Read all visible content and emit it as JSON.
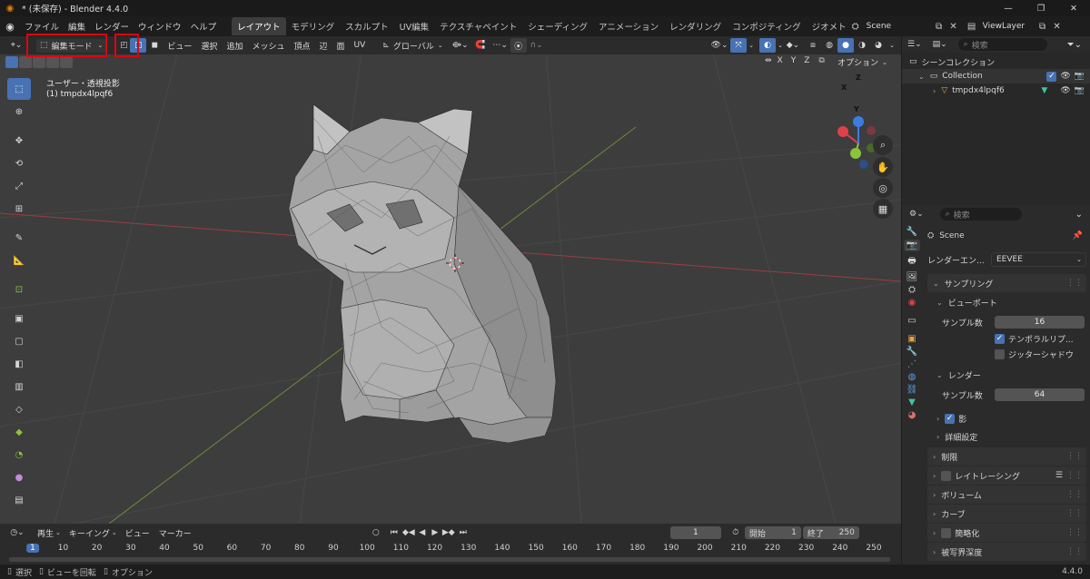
{
  "titlebar": {
    "title": "* (未保存) - Blender 4.4.0",
    "min": "—",
    "max": "❐",
    "close": "✕"
  },
  "menu": [
    "ファイル",
    "編集",
    "レンダー",
    "ウィンドウ",
    "ヘルプ"
  ],
  "workspaces": [
    "レイアウト",
    "モデリング",
    "スカルプト",
    "UV編集",
    "テクスチャペイント",
    "シェーディング",
    "アニメーション",
    "レンダリング",
    "コンポジティング",
    "ジオメトリ"
  ],
  "scene": {
    "label": "Scene",
    "viewlayer": "ViewLayer"
  },
  "viewport_header": {
    "mode": "編集モード",
    "menus": [
      "ビュー",
      "選択",
      "追加",
      "メッシュ",
      "頂点",
      "辺",
      "面",
      "UV"
    ],
    "transform": "グローバル",
    "options": "オプション",
    "axes": [
      "X",
      "Y",
      "Z"
    ]
  },
  "viewport_info": {
    "line1": "ユーザー・透視投影",
    "line2": "(1) tmpdx4lpqf6"
  },
  "gizmo": {
    "x": "X",
    "y": "Y",
    "z": "Z"
  },
  "outliner": {
    "search_placeholder": "検索",
    "scene_collection": "シーンコレクション",
    "collection": "Collection",
    "object": "tmpdx4lpqf6"
  },
  "properties": {
    "search_placeholder": "検索",
    "scene": "Scene",
    "render_engine_label": "レンダーエン...",
    "render_engine": "EEVEE",
    "sampling": "サンプリング",
    "viewport": "ビューポート",
    "samples_label": "サンプル数",
    "viewport_samples": "16",
    "temporal": "テンポラルリプ...",
    "jitter": "ジッターシャドウ",
    "render": "レンダー",
    "render_samples": "64",
    "shadows": "影",
    "advanced": "詳細設定",
    "panels": [
      "制限",
      "レイトレーシング",
      "ボリューム",
      "カーブ",
      "簡略化",
      "被写界深度"
    ]
  },
  "timeline": {
    "menus": [
      "再生",
      "キーイング",
      "ビュー",
      "マーカー"
    ],
    "current_frame": "1",
    "start_label": "開始",
    "start": "1",
    "end_label": "終了",
    "end": "250",
    "ticks": [
      "1",
      "10",
      "20",
      "30",
      "40",
      "50",
      "60",
      "70",
      "80",
      "90",
      "100",
      "110",
      "120",
      "130",
      "140",
      "150",
      "160",
      "170",
      "180",
      "190",
      "200",
      "210",
      "220",
      "230",
      "240",
      "250"
    ]
  },
  "statusbar": {
    "select": "選択",
    "rotate": "ビューを回転",
    "options": "オプション",
    "version": "4.4.0"
  },
  "colors": {
    "accent": "#4772b3",
    "highlight": "#e0000e",
    "x_axis": "#e0404a",
    "y_axis": "#8bc43a",
    "z_axis": "#3b7de0"
  }
}
